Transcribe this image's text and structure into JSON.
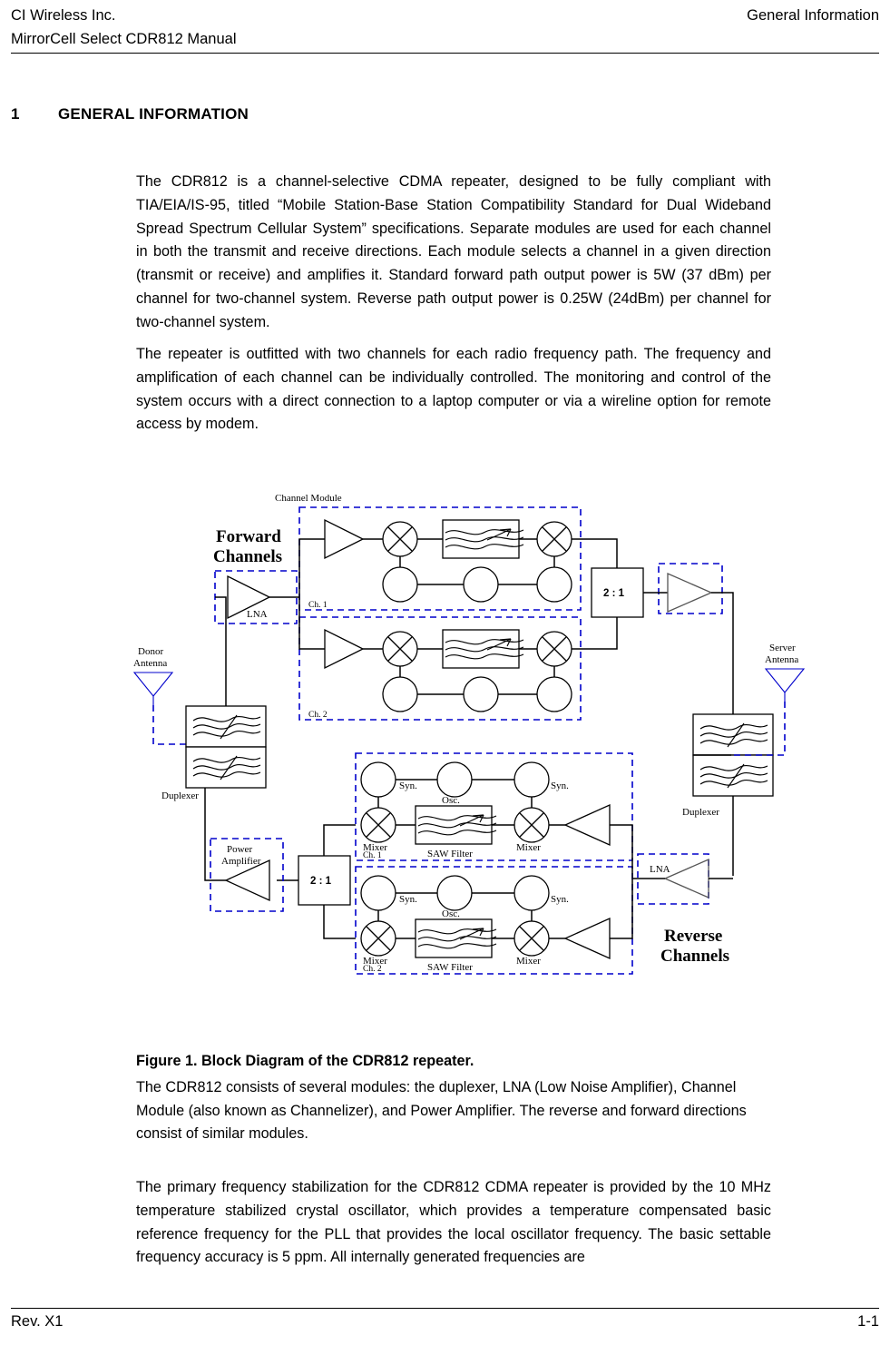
{
  "header": {
    "left_line1": "CI Wireless Inc.",
    "left_line2": "MirrorCell Select CDR812 Manual",
    "right": "General Information"
  },
  "section": {
    "number": "1",
    "title": "GENERAL INFORMATION"
  },
  "paragraphs": {
    "p1": "The CDR812 is a channel-selective CDMA repeater, designed to be fully compliant with TIA/EIA/IS-95, titled “Mobile Station-Base Station Compatibility Standard for Dual Wideband Spread Spectrum Cellular System” specifications. Separate modules are used for each channel in both the transmit and receive directions. Each module selects a channel in a given direction (transmit or receive) and amplifies it. Standard forward path output power is 5W (37 dBm) per channel for two-channel system. Reverse path output power is 0.25W (24dBm) per channel for two-channel system.",
    "p2": "The repeater is outfitted with two channels for each radio frequency path. The frequency and amplification of each channel can be individually controlled. The monitoring and control of the system occurs with a direct connection to a laptop computer or via a wireline option for remote access by modem.",
    "figure_caption": "Figure 1. Block Diagram of the CDR812 repeater.",
    "p3": "The CDR812 consists of several modules: the duplexer, LNA (Low Noise Amplifier), Channel Module (also known as Channelizer), and Power Amplifier. The reverse and forward directions consist of similar modules.",
    "p4": "The primary frequency stabilization for the CDR812 CDMA repeater is provided by the 10 MHz temperature stabilized crystal oscillator, which provides a temperature compensated basic reference frequency for the PLL that provides the local oscillator frequency. The basic settable frequency accuracy is 5 ppm. All internally generated frequencies are"
  },
  "footer": {
    "revision": "Rev. X1",
    "page_number": "1-1"
  },
  "diagram": {
    "title_forward_line1": "Forward",
    "title_forward_line2": "Channels",
    "title_reverse_line1": "Reverse",
    "title_reverse_line2": "Channels",
    "channel_module_label": "Channel Module",
    "donor_antenna_line1": "Donor",
    "donor_antenna_line2": "Antenna",
    "server_antenna_line1": "Server",
    "server_antenna_line2": "Antenna",
    "duplexer_left": "Duplexer",
    "duplexer_right": "Duplexer",
    "lna_forward": "LNA",
    "lna_reverse": "LNA",
    "power_amplifier_line1": "Power",
    "power_amplifier_line2": "Amplifier",
    "combiner_forward": "2 : 1",
    "combiner_reverse": "2 : 1",
    "ch1_forward": "Ch. 1",
    "ch2_forward": "Ch. 2",
    "ch1_reverse": "Ch. 1",
    "ch2_reverse": "Ch. 2",
    "syn_label": "Syn.",
    "osc_label": "Osc.",
    "mixer_label": "Mixer",
    "saw_filter_label": "SAW Filter",
    "colors": {
      "dashed_module_outline": "#0000CC",
      "wire": "#000000",
      "antenna": "#0000CC"
    }
  }
}
